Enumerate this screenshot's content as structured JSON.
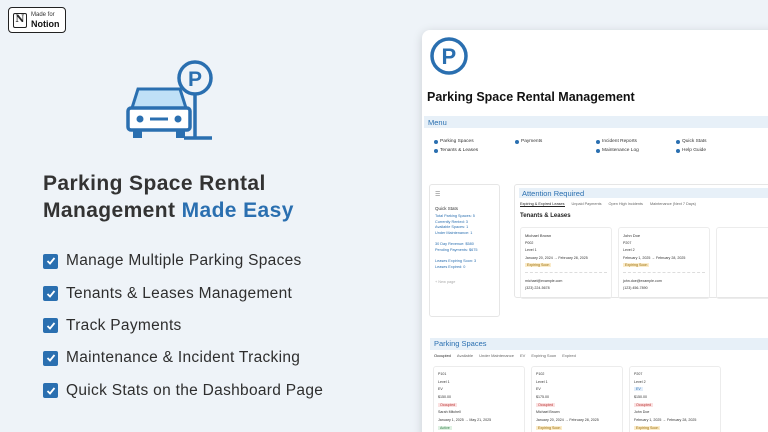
{
  "badge": {
    "line1": "Made for",
    "line2": "Notion",
    "logo_letter": "N"
  },
  "headline": {
    "line1": "Parking Space Rental",
    "line2_main": "Management",
    "line2_accent": "Made Easy"
  },
  "features": [
    "Manage Multiple Parking Spaces",
    "Tenants & Leases Management",
    "Track Payments",
    "Maintenance & Incident Tracking",
    "Quick Stats on the Dashboard Page"
  ],
  "colors": {
    "accent": "#2a6fb0",
    "background": "#eef3f8"
  },
  "panel": {
    "logo_letter": "P",
    "title": "Parking Space Rental Management",
    "menu_label": "Menu",
    "menu": {
      "parking_spaces": "Parking Spaces",
      "tenants_leases": "Tenants & Leases",
      "payments": "Payments",
      "incident_reports": "Incident Reports",
      "maintenance_log": "Maintenance Log",
      "quick_stats": "Quick Stats",
      "help_guide": "Help Guide"
    },
    "quick_stats": {
      "heading": "Quick Stats",
      "rows": [
        "Total Parking Spaces: 5",
        "Currently Rented: 3",
        "Available Spaces: 1",
        "Under Maintenance: 1",
        "30 Day Revenue: $580",
        "Pending Payments: $675",
        "Leases Expiring Soon: 3",
        "Leases Expired: 0"
      ],
      "new_page": "+ New page"
    },
    "attention": {
      "title": "Attention Required",
      "tabs": [
        "Expiring & Expired Leases",
        "Unpaid Payments",
        "Open High Incidents",
        "Maintenance (Next 7 Days)"
      ],
      "subtitle": "Tenants & Leases",
      "cards": [
        {
          "name": "Michael Brown",
          "space": "P002",
          "level": "Level 1",
          "dates": "January 20, 2024 → February 28, 2025",
          "status": "Expiring Soon",
          "email": "michael@example.com",
          "phone": "(323) 224-5678"
        },
        {
          "name": "John Doe",
          "space": "P207",
          "level": "Level 2",
          "dates": "February 1, 2025 → February 28, 2025",
          "status": "Expiring Soon",
          "email": "john.doe@example.com",
          "phone": "(123) 456-7890"
        }
      ]
    },
    "parking_spaces": {
      "title": "Parking Spaces",
      "tabs": [
        "Occupied",
        "Available",
        "Under Maintenance",
        "EV",
        "Expiring Soon",
        "Expired"
      ],
      "cards": [
        {
          "id": "P101",
          "level": "Level 1",
          "ev": "EV",
          "rate": "$150.00",
          "status": "Occupied",
          "tenant": "Sarah Mitchell",
          "dates": "January 1, 2025 → May 21, 2025",
          "lease": "Active"
        },
        {
          "id": "P102",
          "level": "Level 1",
          "ev": "EV",
          "rate": "$175.00",
          "status": "Occupied",
          "tenant": "Michael Brown",
          "dates": "January 20, 2024 → February 28, 2025",
          "lease": "Expiring Soon"
        },
        {
          "id": "P207",
          "level": "Level 2",
          "ev": "EV",
          "rate": "$150.00",
          "status": "Occupied",
          "tenant": "John Doe",
          "dates": "February 1, 2025 → February 28, 2025",
          "lease": "Expiring Soon"
        }
      ]
    }
  }
}
